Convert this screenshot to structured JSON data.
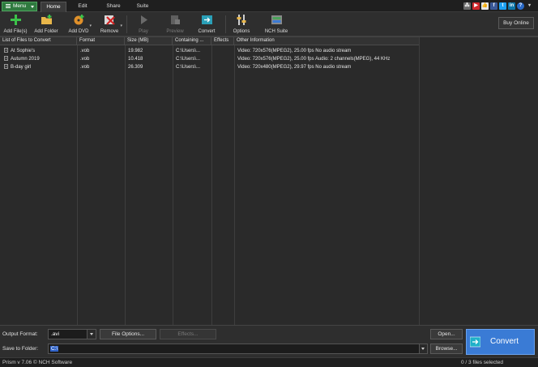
{
  "menu": {
    "label": "Menu"
  },
  "tabs": [
    {
      "label": "Home",
      "active": true
    },
    {
      "label": "Edit",
      "active": false
    },
    {
      "label": "Share",
      "active": false
    },
    {
      "label": "Suite",
      "active": false
    }
  ],
  "toolbar": {
    "add_files": "Add File(s)",
    "add_folder": "Add Folder",
    "add_dvd": "Add DVD",
    "remove": "Remove",
    "play": "Play",
    "preview": "Preview",
    "convert": "Convert",
    "options": "Options",
    "nch_suite": "NCH Suite",
    "buy_online": "Buy Online"
  },
  "table": {
    "columns": [
      "List of Files to Convert",
      "Format",
      "Size (MB)",
      "Containing ...",
      "Effects",
      "Other Information"
    ],
    "rows": [
      {
        "name": "At Sophie's",
        "format": ".vob",
        "size": "19.982",
        "folder": "C:\\Users\\...",
        "effects": "",
        "info": "Video: 720x576(MPEG2), 25.00 fps No audio stream"
      },
      {
        "name": "Autumn 2019",
        "format": ".vob",
        "size": "10.418",
        "folder": "C:\\Users\\...",
        "effects": "",
        "info": "Video: 720x576(MPEG2), 25.00 fps Audio: 2 channels(MPEG), 44 KHz"
      },
      {
        "name": "B-day girl",
        "format": ".vob",
        "size": "26.309",
        "folder": "C:\\Users\\...",
        "effects": "",
        "info": "Video: 720x480(MPEG2), 29.97 fps No audio stream"
      }
    ]
  },
  "bottom": {
    "output_format_label": "Output Format:",
    "output_format_value": ".avi",
    "file_options": "File Options...",
    "effects": "Effects...",
    "save_to_label": "Save to Folder:",
    "save_to_value": "C:\\",
    "open": "Open...",
    "browse": "Browse...",
    "convert": "Convert"
  },
  "status": {
    "left": "Prism v 7.06 © NCH Software",
    "right": "0 / 3 files selected"
  },
  "colors": {
    "accent_green": "#2f7a3f",
    "convert_blue": "#3a7bd5",
    "selection_blue": "#2f62c8"
  }
}
